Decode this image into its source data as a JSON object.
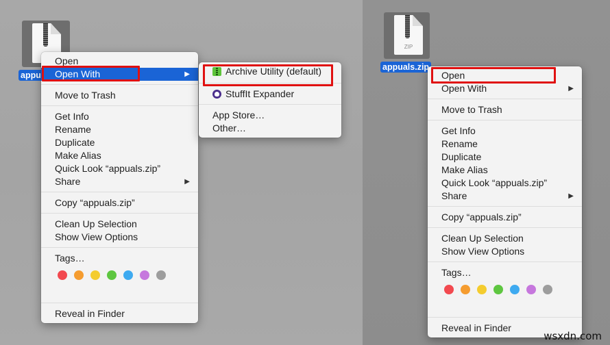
{
  "file": {
    "name": "appuals.zip",
    "name_truncated": "appu",
    "type_label": "ZIP"
  },
  "context_menu": {
    "items": [
      {
        "label": "Open"
      },
      {
        "label": "Open With",
        "has_submenu": true
      },
      {
        "label": "Move to Trash"
      },
      {
        "label": "Get Info"
      },
      {
        "label": "Rename"
      },
      {
        "label": "Duplicate"
      },
      {
        "label": "Make Alias"
      },
      {
        "label": "Quick Look “appuals.zip”"
      },
      {
        "label": "Share",
        "has_submenu": true
      },
      {
        "label": "Copy “appuals.zip”"
      },
      {
        "label": "Clean Up Selection"
      },
      {
        "label": "Show View Options"
      },
      {
        "label": "Tags…"
      },
      {
        "label": "Reveal in Finder"
      }
    ],
    "submenu_arrow": "▶",
    "tags": [
      {
        "name": "red",
        "color": "#f2494f"
      },
      {
        "name": "orange",
        "color": "#f59c2f"
      },
      {
        "name": "yellow",
        "color": "#f4cc2e"
      },
      {
        "name": "green",
        "color": "#5ec640"
      },
      {
        "name": "blue",
        "color": "#3eaaf0"
      },
      {
        "name": "purple",
        "color": "#c677dd"
      },
      {
        "name": "gray",
        "color": "#9d9d9d"
      }
    ]
  },
  "open_with_submenu": {
    "items": [
      {
        "label": "Archive Utility (default)",
        "icon": "archive-utility-icon"
      },
      {
        "label": "StuffIt Expander",
        "icon": "stuffit-expander-icon"
      },
      {
        "label": "App Store…"
      },
      {
        "label": "Other…"
      }
    ]
  },
  "colors": {
    "highlight": "#1a64d6",
    "callout": "#e01010"
  },
  "watermark": "wsxdn.com"
}
